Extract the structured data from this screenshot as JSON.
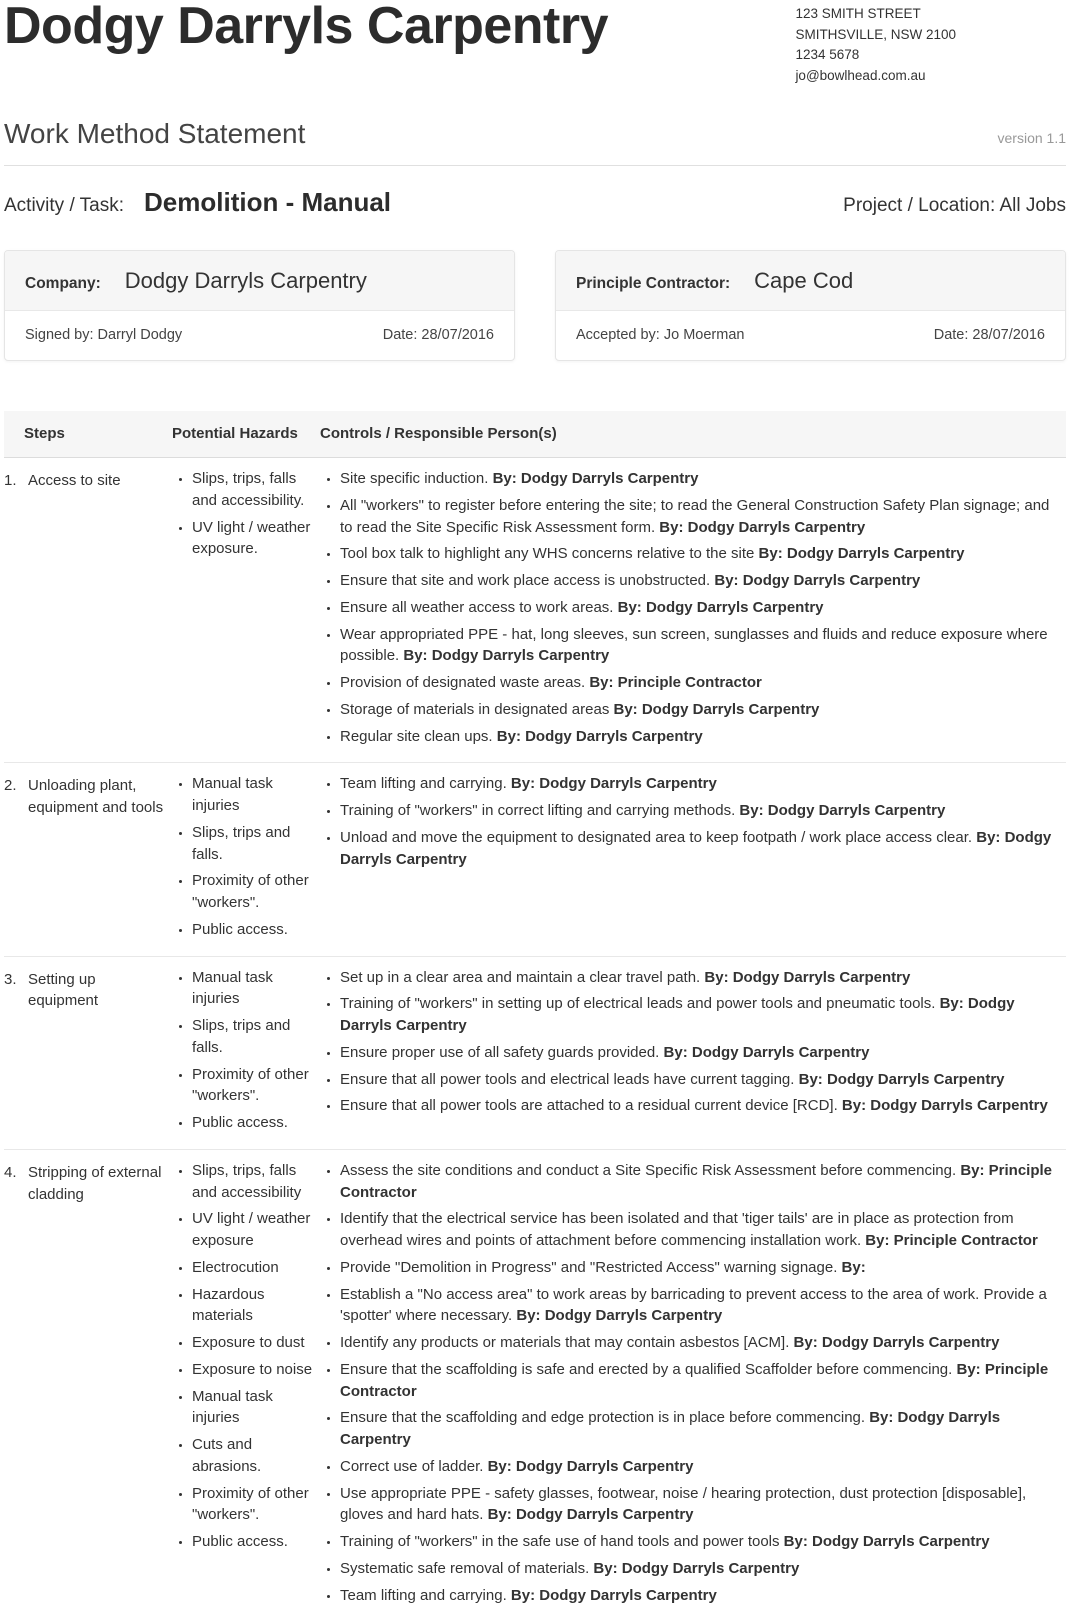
{
  "header": {
    "company_name": "Dodgy Darryls Carpentry",
    "address_line1": "123 SMITH STREET",
    "address_line2": "SMITHSVILLE, NSW 2100",
    "phone": "1234 5678",
    "email": "jo@bowlhead.com.au"
  },
  "doc": {
    "type": "Work Method Statement",
    "version": "version 1.1"
  },
  "activity": {
    "label": "Activity / Task:",
    "value": "Demolition - Manual",
    "project_label": "Project / Location: All Jobs"
  },
  "company_card": {
    "label": "Company:",
    "value": "Dodgy Darryls Carpentry",
    "signed_label": "Signed by: Darryl Dodgy",
    "date_label": "Date: 28/07/2016"
  },
  "contractor_card": {
    "label": "Principle Contractor:",
    "value": "Cape Cod",
    "accepted_label": "Accepted by: Jo Moerman",
    "date_label": "Date: 28/07/2016"
  },
  "table_headers": {
    "steps": "Steps",
    "hazards": "Potential Hazards",
    "controls": "Controls / Responsible Person(s)"
  },
  "rows": [
    {
      "num": "1.",
      "step": "Access to site",
      "hazards": [
        "Slips, trips, falls and accessibility.",
        "UV light / weather exposure."
      ],
      "controls": [
        {
          "text": "Site specific induction.",
          "by": "By: Dodgy Darryls Carpentry"
        },
        {
          "text": "All \"workers\" to register before entering the site; to read the General Construction Safety Plan signage; and to read the Site Specific Risk Assessment form.",
          "by": "By: Dodgy Darryls Carpentry"
        },
        {
          "text": "Tool box talk to highlight any WHS concerns relative to the site",
          "by": "By: Dodgy Darryls Carpentry"
        },
        {
          "text": "Ensure that site and work place access is unobstructed.",
          "by": "By: Dodgy Darryls Carpentry"
        },
        {
          "text": "Ensure all weather access to work areas.",
          "by": "By: Dodgy Darryls Carpentry"
        },
        {
          "text": "Wear appropriated PPE - hat, long sleeves, sun screen, sunglasses and fluids and reduce exposure where possible.",
          "by": "By: Dodgy Darryls Carpentry"
        },
        {
          "text": "Provision of designated waste areas.",
          "by": "By: Principle Contractor"
        },
        {
          "text": "Storage of materials in designated areas",
          "by": "By: Dodgy Darryls Carpentry"
        },
        {
          "text": "Regular site clean ups.",
          "by": "By: Dodgy Darryls Carpentry"
        }
      ]
    },
    {
      "num": "2.",
      "step": "Unloading plant, equipment and tools",
      "hazards": [
        "Manual task injuries",
        "Slips, trips and falls.",
        "Proximity of other \"workers\".",
        "Public access."
      ],
      "controls": [
        {
          "text": "Team lifting and carrying.",
          "by": "By: Dodgy Darryls Carpentry"
        },
        {
          "text": "Training of \"workers\" in correct lifting and carrying methods.",
          "by": "By: Dodgy Darryls Carpentry"
        },
        {
          "text": "Unload and move the equipment to designated area to keep footpath / work place access clear.",
          "by": "By: Dodgy Darryls Carpentry"
        }
      ]
    },
    {
      "num": "3.",
      "step": "Setting up equipment",
      "hazards": [
        "Manual task injuries",
        "Slips, trips and falls.",
        "Proximity of other \"workers\".",
        "Public access."
      ],
      "controls": [
        {
          "text": "Set up in a clear area and maintain a clear travel path.",
          "by": "By: Dodgy Darryls Carpentry"
        },
        {
          "text": "Training of \"workers\" in setting up of electrical leads and power tools and pneumatic tools.",
          "by": "By: Dodgy Darryls Carpentry"
        },
        {
          "text": "Ensure proper use of all safety guards provided.",
          "by": "By: Dodgy Darryls Carpentry"
        },
        {
          "text": "Ensure that all power tools and electrical leads have current tagging.",
          "by": "By: Dodgy Darryls Carpentry"
        },
        {
          "text": "Ensure that all power tools are attached to a residual current device [RCD].",
          "by": "By: Dodgy Darryls Carpentry"
        }
      ]
    },
    {
      "num": "4.",
      "step": "Stripping of external cladding",
      "hazards": [
        "Slips, trips, falls and accessibility",
        "UV light / weather exposure",
        "Electrocution",
        "Hazardous materials",
        "Exposure to dust",
        "Exposure to noise",
        "Manual task injuries",
        "Cuts and abrasions.",
        "Proximity of other \"workers\".",
        "Public access."
      ],
      "controls": [
        {
          "text": "Assess the site conditions and conduct a Site Specific Risk Assessment before commencing.",
          "by": "By: Principle Contractor"
        },
        {
          "text": "Identify that the electrical service has been isolated and that 'tiger tails' are in place as protection from overhead wires and points of attachment before commencing installation work.",
          "by": "By: Principle Contractor"
        },
        {
          "text": "Provide \"Demolition in Progress\" and \"Restricted Access\" warning signage.",
          "by": "By:"
        },
        {
          "text": "Establish a \"No access area\" to work areas by barricading to prevent access to the area of work. Provide a 'spotter' where necessary.",
          "by": "By: Dodgy Darryls Carpentry"
        },
        {
          "text": "Identify any products or materials that may contain asbestos [ACM].",
          "by": "By: Dodgy Darryls Carpentry"
        },
        {
          "text": "Ensure that the scaffolding is safe and erected by a qualified Scaffolder before commencing.",
          "by": "By: Principle Contractor"
        },
        {
          "text": "Ensure that the scaffolding and edge protection is in place before commencing.",
          "by": "By: Dodgy Darryls Carpentry"
        },
        {
          "text": "Correct use of ladder.",
          "by": "By: Dodgy Darryls Carpentry"
        },
        {
          "text": "Use appropriate PPE - safety glasses, footwear, noise / hearing protection, dust protection [disposable], gloves and hard hats.",
          "by": "By: Dodgy Darryls Carpentry"
        },
        {
          "text": "Training of \"workers\" in the safe use of hand tools and power tools",
          "by": "By: Dodgy Darryls Carpentry"
        },
        {
          "text": "Systematic safe removal of materials.",
          "by": "By: Dodgy Darryls Carpentry"
        },
        {
          "text": "Team lifting and carrying.",
          "by": "By: Dodgy Darryls Carpentry"
        }
      ]
    }
  ]
}
